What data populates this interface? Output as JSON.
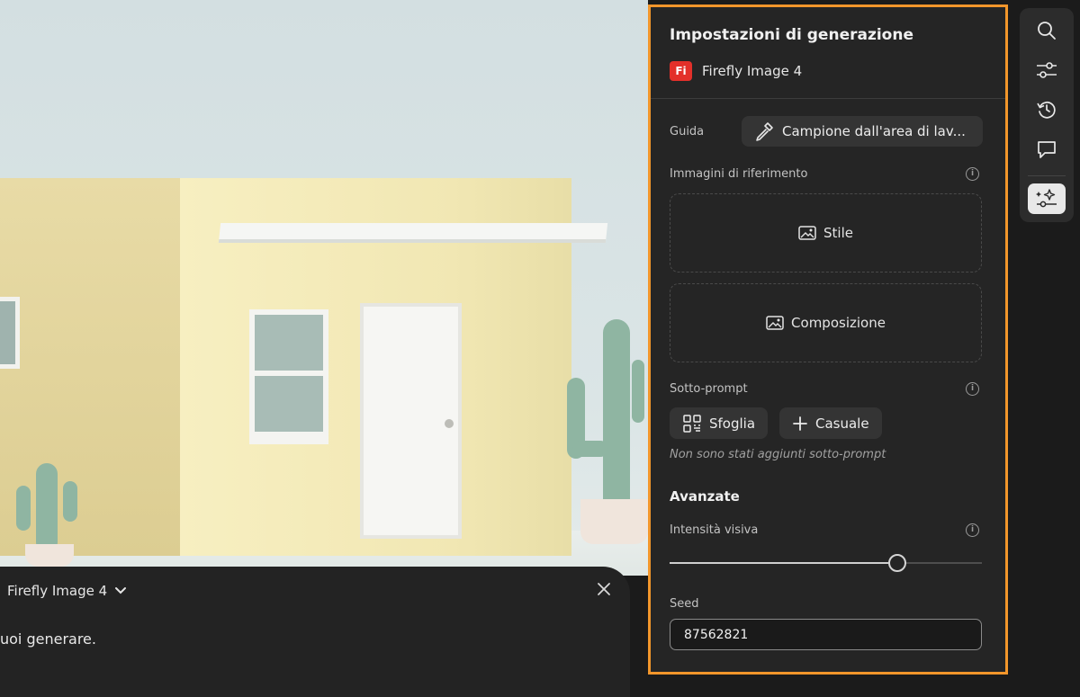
{
  "prompt_panel": {
    "model_label": "Firefly Image 4",
    "prompt_text": "uoi generare."
  },
  "settings": {
    "title": "Impostazioni di generazione",
    "model_badge": "Fi",
    "model_name": "Firefly Image 4",
    "guide_label": "Guida",
    "guide_button": "Campione dall'area di lav...",
    "reference_label": "Immagini di riferimento",
    "style_zone": "Stile",
    "composition_zone": "Composizione",
    "subprompt_label": "Sotto-prompt",
    "browse_button": "Sfoglia",
    "random_button": "Casuale",
    "no_subprompt_hint": "Non sono stati aggiunti sotto-prompt",
    "advanced_heading": "Avanzate",
    "visual_intensity_label": "Intensità visiva",
    "visual_intensity_value": 0.73,
    "seed_label": "Seed",
    "seed_value": "87562821"
  },
  "rail": {
    "icons": [
      "search-icon",
      "sliders-icon",
      "history-icon",
      "comment-icon",
      "generate-settings-icon"
    ],
    "active": "generate-settings-icon"
  },
  "colors": {
    "highlight_border": "#f2962b",
    "firefly_badge": "#e3302a",
    "panel_bg": "#252525"
  }
}
